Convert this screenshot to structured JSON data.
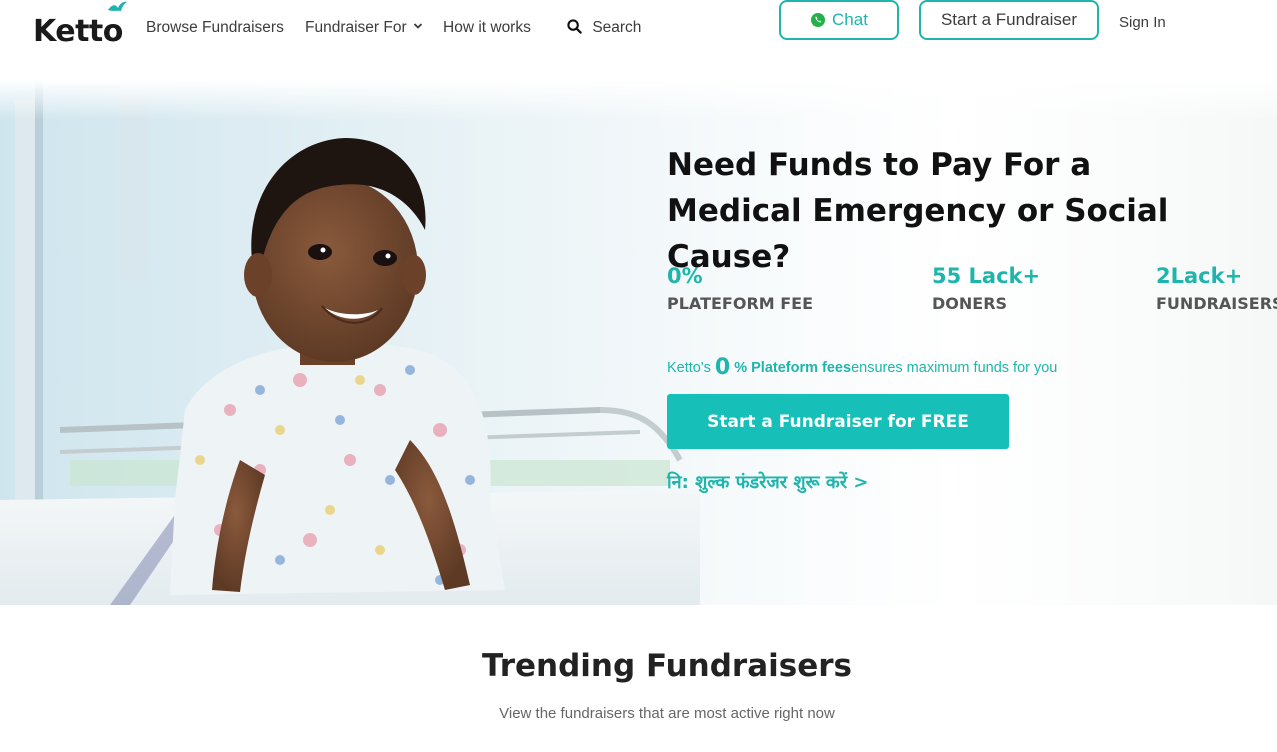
{
  "header": {
    "logo_text": "Ketto",
    "nav": {
      "browse": "Browse Fundraisers",
      "fundraiser_for": "Fundraiser For",
      "how_it_works": "How it works",
      "search": "Search"
    },
    "chat_label": "Chat",
    "start_label": "Start a Fundraiser",
    "signin_label": "Sign In"
  },
  "hero": {
    "headline": "Need Funds to Pay For a Medical Emergency or Social Cause?",
    "stats": [
      {
        "value": "0%",
        "label": "PLATEFORM FEE"
      },
      {
        "value": "55 Lack+",
        "label": "DONERS"
      },
      {
        "value": "2Lack+",
        "label": "FUNDRAISERS"
      }
    ],
    "fee_line": {
      "prefix": "Ketto's",
      "big": "0",
      "bold": "% Plateform fees",
      "suffix": "ensures maximum funds for you"
    },
    "cta_label": "Start a Fundraiser for FREE",
    "hindi_link": "नि: शुल्क फंडरेजर शुरू करें >"
  },
  "trending": {
    "title": "Trending Fundraisers",
    "subtitle": "View the fundraisers that are most active right now"
  },
  "colors": {
    "accent": "#1fb5ad",
    "cta": "#16bfb7",
    "text_dark": "#111111"
  },
  "icons": [
    "bird-icon",
    "chevron-down-icon",
    "search-icon",
    "whatsapp-icon"
  ]
}
